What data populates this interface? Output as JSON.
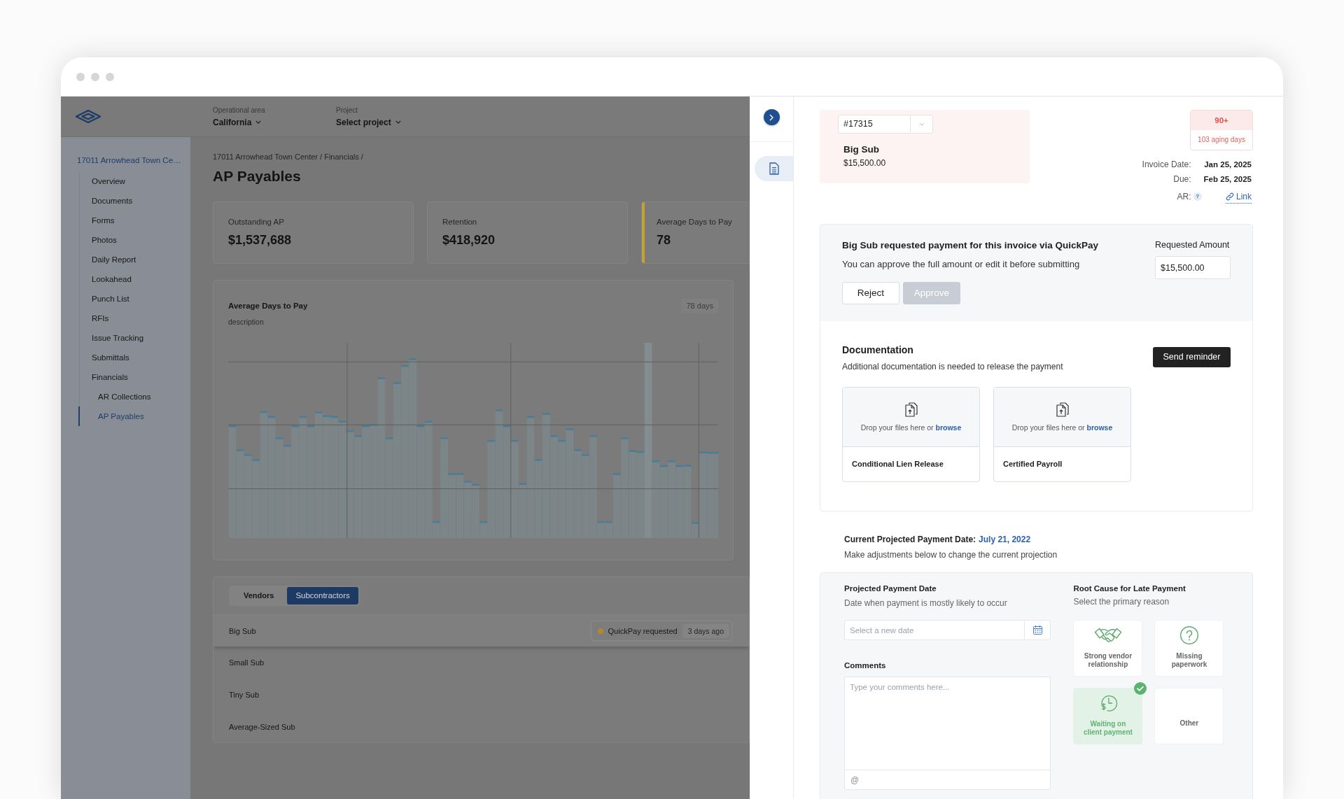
{
  "header": {
    "filters": [
      {
        "label": "Operational area",
        "value": "California"
      },
      {
        "label": "Project",
        "value": "Select project"
      }
    ]
  },
  "sidebar": {
    "project": "17011 Arrowhead Town Ce…",
    "items": [
      {
        "label": "Overview",
        "selected": false
      },
      {
        "label": "Documents",
        "selected": false
      },
      {
        "label": "Forms",
        "selected": false
      },
      {
        "label": "Photos",
        "selected": false
      },
      {
        "label": "Daily Report",
        "selected": false
      },
      {
        "label": "Lookahead",
        "selected": false
      },
      {
        "label": "Punch List",
        "selected": false
      },
      {
        "label": "RFIs",
        "selected": false
      },
      {
        "label": "Issue Tracking",
        "selected": false
      },
      {
        "label": "Submittals",
        "selected": false
      },
      {
        "label": "Financials",
        "selected": false,
        "children": [
          {
            "label": "AR Collections",
            "selected": false
          },
          {
            "label": "AP Payables",
            "selected": true
          }
        ]
      }
    ]
  },
  "breadcrumb": "17011 Arrowhead Town Center / Financials /",
  "page_title": "AP Payables",
  "stats": [
    {
      "label": "Outstanding AP",
      "value": "$1,537,688"
    },
    {
      "label": "Retention",
      "value": "$418,920"
    },
    {
      "label": "Average Days to Pay",
      "value": "78",
      "color": "#c4a32b"
    }
  ],
  "chart_card": {
    "title": "Average Days to Pay",
    "description": "description",
    "badge": "78 days"
  },
  "payees": {
    "tabs": [
      {
        "label": "Vendors",
        "selected": false
      },
      {
        "label": "Subcontractors",
        "selected": true
      }
    ],
    "rows": [
      {
        "name": "Big Sub",
        "selected": true,
        "status": {
          "label": "QuickPay requested",
          "age": "3 days ago",
          "color": "#b7862b"
        }
      },
      {
        "name": "Small Sub",
        "selected": false
      },
      {
        "name": "Tiny Sub",
        "selected": false
      },
      {
        "name": "Average-Sized Sub",
        "selected": false
      }
    ]
  },
  "invoice_panel": {
    "rail": {
      "tabs": [
        {
          "selected": true
        }
      ]
    },
    "invoice": {
      "number": "#17315",
      "vendor": "Big Sub",
      "amount": "$15,500.00"
    },
    "aging": {
      "bucket": "90+",
      "days": "103 aging days"
    },
    "details": [
      {
        "label": "Invoice Date:",
        "value": "Jan 25, 2025"
      },
      {
        "label": "Due:",
        "value": "Feb 25, 2025"
      }
    ],
    "ar": {
      "label": "AR:",
      "help": "?",
      "link": "Link"
    },
    "quickpay": {
      "title": "Big Sub requested payment for this invoice via QuickPay",
      "subtitle": "You can approve the full amount or edit it before submitting",
      "buttons": [
        {
          "label": "Reject",
          "disabled": false
        },
        {
          "label": "Approve",
          "disabled": true
        }
      ],
      "amount_label": "Requested Amount",
      "amount": "$15,500.00"
    },
    "documentation": {
      "title": "Documentation",
      "subtitle": "Additional documentation is needed to release the payment",
      "action": "Send reminder",
      "uploads": [
        {
          "hint": "Drop your files here or",
          "link": "browse",
          "label": "Conditional Lien Release"
        },
        {
          "hint": "Drop your files here or",
          "link": "browse",
          "label": "Certified Payroll"
        }
      ]
    },
    "projection": {
      "label": "Current Projected Payment Date:",
      "date": "July 21, 2022",
      "subtitle": "Make adjustments below to change the current projection"
    },
    "date_field": {
      "title": "Projected Payment Date",
      "subtitle": "Date when payment is mostly likely to occur",
      "placeholder": "Select a new date"
    },
    "comments": {
      "title": "Comments",
      "placeholder": "Type your comments here...",
      "mention": "@"
    },
    "root_cause": {
      "title": "Root Cause for Late Payment",
      "subtitle": "Select the primary reason",
      "options": [
        {
          "label": "Strong vendor relationship",
          "selected": false
        },
        {
          "label": "Missing paperwork",
          "selected": false
        },
        {
          "label": "Waiting on client payment",
          "selected": true
        },
        {
          "label": "Other",
          "selected": false
        }
      ]
    }
  }
}
